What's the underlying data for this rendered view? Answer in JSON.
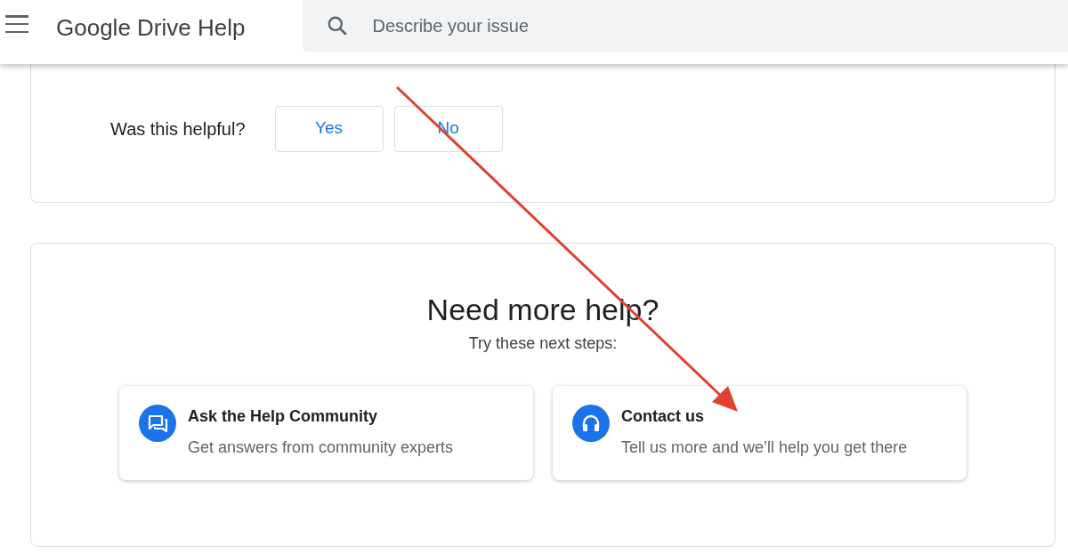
{
  "header": {
    "title": "Google Drive Help",
    "search": {
      "placeholder": "Describe your issue"
    }
  },
  "feedback": {
    "question": "Was this helpful?",
    "buttons": [
      "Yes",
      "No"
    ]
  },
  "help": {
    "heading": "Need more help?",
    "subtitle": "Try these next steps:",
    "options": [
      {
        "kind": "community",
        "title": "Ask the Help Community",
        "description": "Get answers from community experts"
      },
      {
        "kind": "contact",
        "title": "Contact us",
        "description": "Tell us more and we’ll help you get there"
      }
    ]
  }
}
